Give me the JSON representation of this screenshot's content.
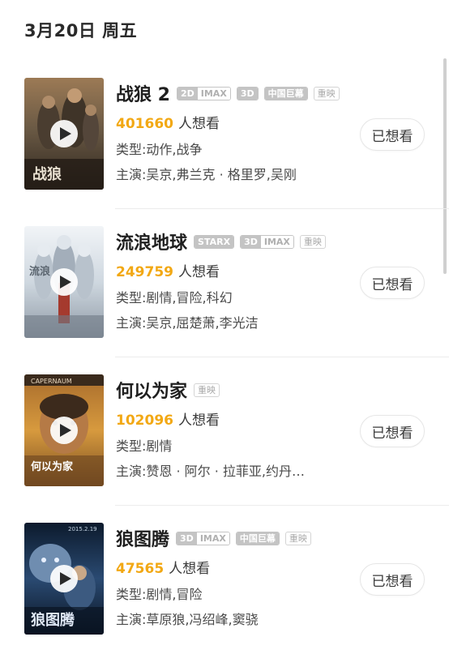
{
  "date_header": "3月20日 周五",
  "movies": [
    {
      "title": "战狼 2",
      "badges": [
        {
          "type": "split",
          "parts": [
            "2D",
            "IMAX"
          ]
        },
        {
          "type": "solid",
          "parts": [
            "3D"
          ]
        },
        {
          "type": "solid",
          "parts": [
            "中国巨幕"
          ]
        },
        {
          "type": "outline",
          "parts": [
            "重映"
          ]
        }
      ],
      "want_count": "401660",
      "want_suffix": "人想看",
      "genre": "类型:动作,战争",
      "cast": "主演:吴京,弗兰克 · 格里罗,吴刚",
      "button_label": "已想看",
      "poster_colors": [
        "#6b5a45",
        "#b48a5e",
        "#3e3328"
      ]
    },
    {
      "title": "流浪地球",
      "badges": [
        {
          "type": "solid",
          "parts": [
            "STARX"
          ]
        },
        {
          "type": "split",
          "parts": [
            "3D",
            "IMAX"
          ]
        },
        {
          "type": "outline",
          "parts": [
            "重映"
          ]
        }
      ],
      "want_count": "249759",
      "want_suffix": "人想看",
      "genre": "类型:剧情,冒险,科幻",
      "cast": "主演:吴京,屈楚萧,李光洁",
      "button_label": "已想看",
      "poster_colors": [
        "#e9eef2",
        "#b8c2cc",
        "#a53a2e"
      ]
    },
    {
      "title": "何以为家",
      "badges": [
        {
          "type": "outline",
          "parts": [
            "重映"
          ]
        }
      ],
      "want_count": "102096",
      "want_suffix": "人想看",
      "genre": "类型:剧情",
      "cast": "主演:赞恩 · 阿尔 · 拉菲亚,约丹…",
      "button_label": "已想看",
      "poster_colors": [
        "#d79a3e",
        "#8a5a2a",
        "#f0c070"
      ]
    },
    {
      "title": "狼图腾",
      "badges": [
        {
          "type": "split",
          "parts": [
            "3D",
            "IMAX"
          ]
        },
        {
          "type": "solid",
          "parts": [
            "中国巨幕"
          ]
        },
        {
          "type": "outline",
          "parts": [
            "重映"
          ]
        }
      ],
      "want_count": "47565",
      "want_suffix": "人想看",
      "genre": "类型:剧情,冒险",
      "cast": "主演:草原狼,冯绍峰,窦骁",
      "button_label": "已想看",
      "poster_colors": [
        "#1e3a5c",
        "#5c7fa6",
        "#0c1a2c"
      ]
    }
  ],
  "poster_texts": {
    "wolf_warrior_date": "2015.2.19",
    "capernaum_header": "CAPERNAUM"
  },
  "colors": {
    "want_count": "#f2a814",
    "badge_gray": "#c4c4c4",
    "divider": "#ececec"
  },
  "icons": {
    "play": "play-icon"
  }
}
